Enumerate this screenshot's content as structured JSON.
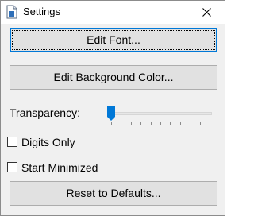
{
  "window": {
    "title": "Settings"
  },
  "buttons": {
    "edit_font": "Edit Font...",
    "edit_background": "Edit Background Color...",
    "reset": "Reset to Defaults..."
  },
  "transparency": {
    "label": "Transparency:",
    "value_fraction": 0.0,
    "tick_count": 11
  },
  "checkboxes": [
    {
      "label": "Digits Only",
      "checked": false
    },
    {
      "label": "Start Minimized",
      "checked": false
    }
  ],
  "colors": {
    "accent": "#0078d7",
    "button_face": "#e1e1e1",
    "window_bg": "#f0f0f0"
  }
}
